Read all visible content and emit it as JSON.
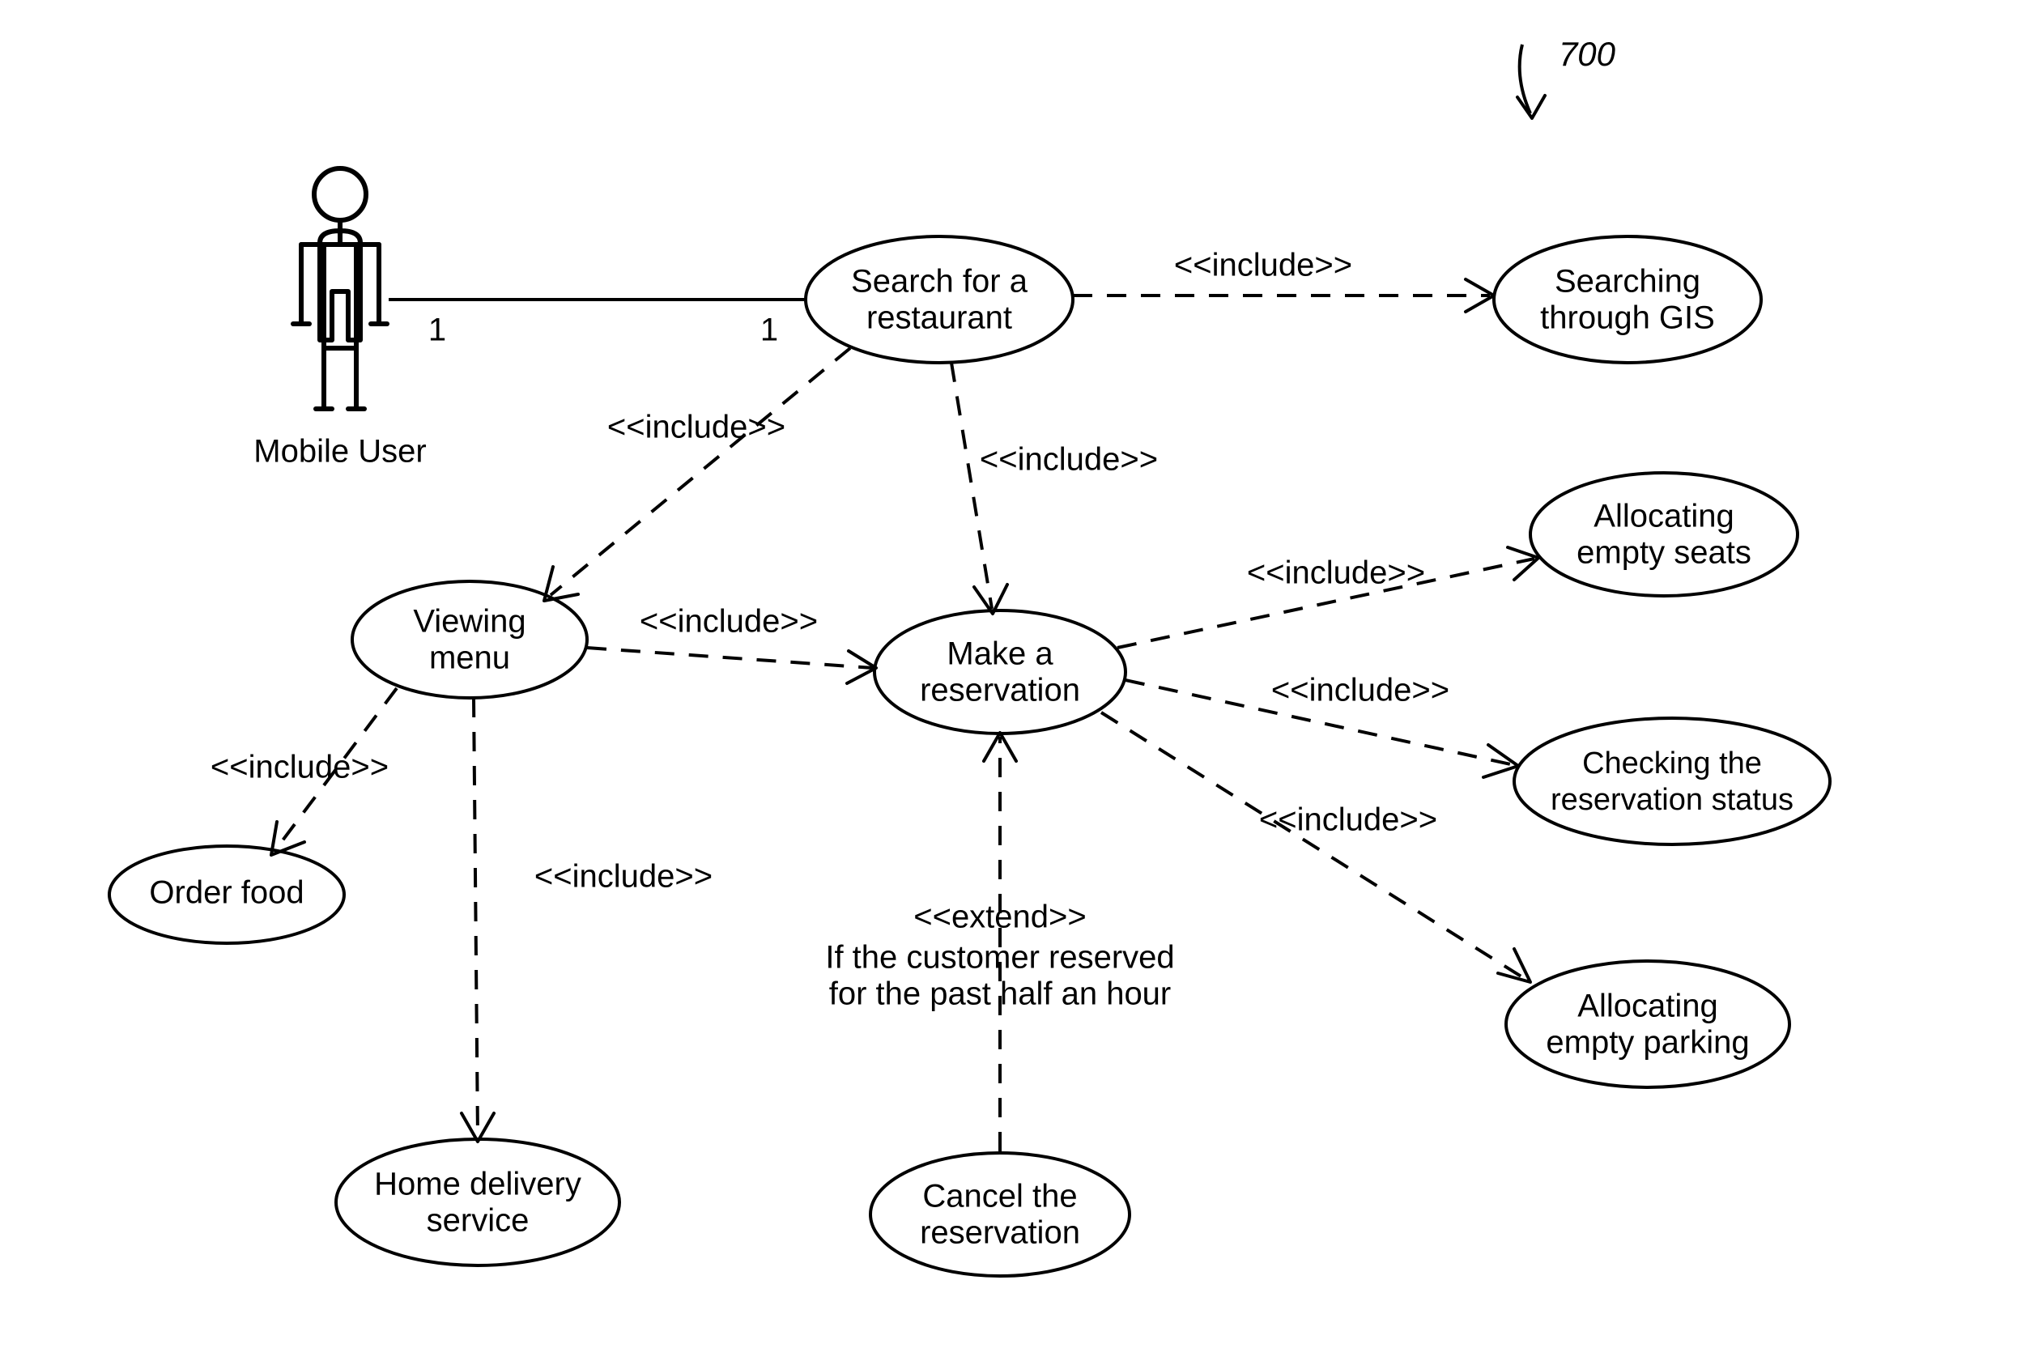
{
  "refNumber": "700",
  "actor": {
    "label": "Mobile User"
  },
  "multiplicity": {
    "left": "1",
    "right": "1"
  },
  "usecases": {
    "search": {
      "line1": "Search for a",
      "line2": "restaurant"
    },
    "gis": {
      "line1": "Searching",
      "line2": "through GIS"
    },
    "viewMenu": {
      "line1": "Viewing",
      "line2": "menu"
    },
    "makeRes": {
      "line1": "Make a",
      "line2": "reservation"
    },
    "allocSeats": {
      "line1": "Allocating",
      "line2": "empty seats"
    },
    "checkStatus": {
      "line1": "Checking the",
      "line2": "reservation status"
    },
    "allocParking": {
      "line1": "Allocating",
      "line2": "empty parking"
    },
    "orderFood": {
      "line1": "Order food"
    },
    "homeDelivery": {
      "line1": "Home delivery",
      "line2": "service"
    },
    "cancelRes": {
      "line1": "Cancel the",
      "line2": "reservation"
    }
  },
  "stereotypes": {
    "include": "<<include>>",
    "extend": "<<extend>>"
  },
  "extendCondition": {
    "line1": "If the customer reserved",
    "line2": "for the past half an hour"
  }
}
